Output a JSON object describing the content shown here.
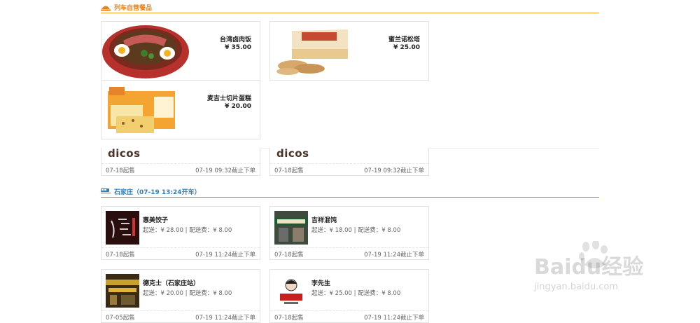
{
  "section1": {
    "title": "列车自营餐品",
    "icon": "food-icon",
    "accent": "#e8821a"
  },
  "products": [
    {
      "name": "台湾卤肉饭",
      "price": "¥ 35.00"
    },
    {
      "name": "蜜兰诺松塔",
      "price": "¥ 25.00"
    },
    {
      "name": "麦吉士切片蛋糕",
      "price": "¥ 20.00"
    }
  ],
  "dicos": [
    {
      "logo": "dicos",
      "open": "07-18起售",
      "deadline": "07-19 09:32截止下单"
    },
    {
      "logo": "dicos",
      "open": "07-18起售",
      "deadline": "07-19 09:32截止下单"
    }
  ],
  "section2": {
    "title": "石家庄（07-19 13:24开车）",
    "icon": "train-icon",
    "accent": "#2f80c0"
  },
  "shops": [
    {
      "name": "惠美饺子",
      "info": "起送：¥ 28.00 | 配送费：¥ 8.00",
      "open": "07-18起售",
      "deadline": "07-19 11:24截止下单"
    },
    {
      "name": "吉祥混饨",
      "info": "起送：¥ 18.00 | 配送费：¥ 8.00",
      "open": "07-18起售",
      "deadline": "07-19 11:24截止下单"
    },
    {
      "name": "德克士（石家庄站）",
      "info": "起送：¥ 20.00 | 配送费：¥ 8.00",
      "open": "07-05起售",
      "deadline": "07-19 11:24截止下单"
    },
    {
      "name": "李先生",
      "info": "起送：¥ 25.00 | 配送费：¥ 8.00",
      "open": "07-18起售",
      "deadline": "07-19 11:24截止下单"
    }
  ],
  "watermark": {
    "main": "Baidu经验",
    "sub": "jingyan.baidu.com"
  }
}
